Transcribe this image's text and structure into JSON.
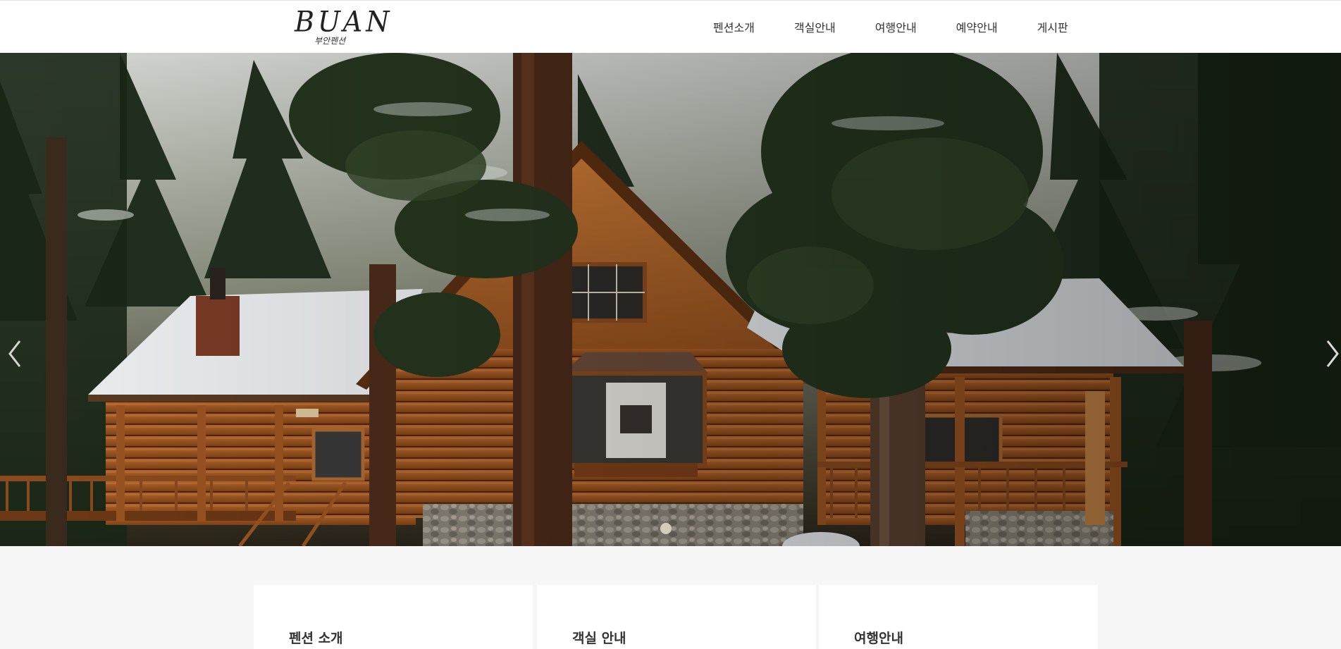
{
  "logo": {
    "main": "BUAN",
    "sub": "부안펜션"
  },
  "nav": {
    "items": [
      {
        "label": "펜션소개"
      },
      {
        "label": "객실안내"
      },
      {
        "label": "여행안내"
      },
      {
        "label": "예약안내"
      },
      {
        "label": "게시판"
      }
    ]
  },
  "hero": {
    "icons": {
      "prev": "chevron-left-icon",
      "next": "chevron-right-icon"
    }
  },
  "cards": [
    {
      "title": "펜션 소개"
    },
    {
      "title": "객실 안내"
    },
    {
      "title": "여행안내"
    }
  ],
  "colors": {
    "header_bg": "#ffffff",
    "page_bg": "#f6f6f6",
    "text": "#333333"
  }
}
